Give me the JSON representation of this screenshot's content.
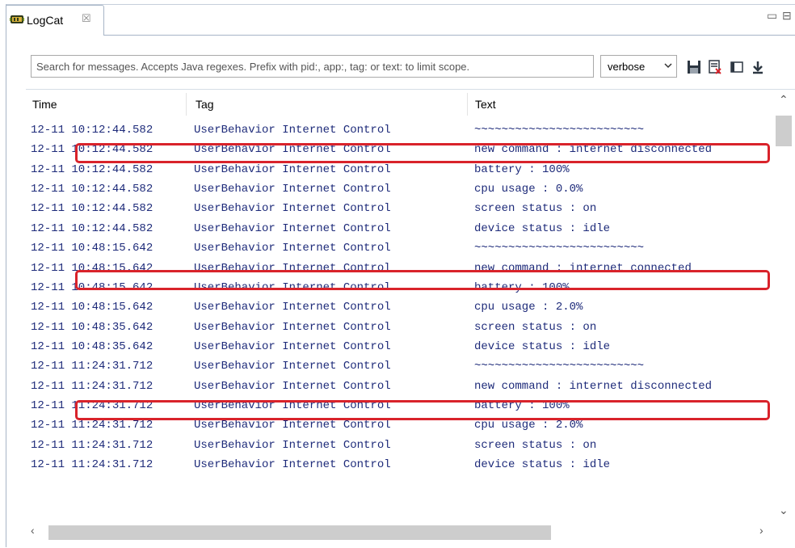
{
  "tab": {
    "title": "LogCat",
    "close": "☒"
  },
  "window_buttons": {
    "minimize": "▭",
    "maximize": "⊟"
  },
  "toolbar": {
    "search_placeholder": "Search for messages. Accepts Java regexes. Prefix with pid:, app:, tag: or text: to limit scope.",
    "level": "verbose",
    "icons": [
      "save-icon",
      "clear-log-icon",
      "toggle-panel-icon",
      "scroll-lock-icon"
    ]
  },
  "table": {
    "headers": {
      "time": "Time",
      "tag": "Tag",
      "text": "Text"
    },
    "rows": [
      {
        "time": "12-11 10:12:44.582",
        "tag": "UserBehavior Internet Control",
        "text": "~~~~~~~~~~~~~~~~~~~~~~~~~"
      },
      {
        "time": "12-11 10:12:44.582",
        "tag": "UserBehavior Internet Control",
        "text": "new command : internet disconnected"
      },
      {
        "time": "12-11 10:12:44.582",
        "tag": "UserBehavior Internet Control",
        "text": "battery : 100%"
      },
      {
        "time": "12-11 10:12:44.582",
        "tag": "UserBehavior Internet Control",
        "text": "cpu usage : 0.0%"
      },
      {
        "time": "12-11 10:12:44.582",
        "tag": "UserBehavior Internet Control",
        "text": "screen status : on"
      },
      {
        "time": "12-11 10:12:44.582",
        "tag": "UserBehavior Internet Control",
        "text": "device status : idle"
      },
      {
        "time": "12-11 10:48:15.642",
        "tag": "UserBehavior Internet Control",
        "text": "~~~~~~~~~~~~~~~~~~~~~~~~~"
      },
      {
        "time": "12-11 10:48:15.642",
        "tag": "UserBehavior Internet Control",
        "text": "new command : internet connected"
      },
      {
        "time": "12-11 10:48:15.642",
        "tag": "UserBehavior Internet Control",
        "text": "battery : 100%"
      },
      {
        "time": "12-11 10:48:15.642",
        "tag": "UserBehavior Internet Control",
        "text": "cpu usage : 2.0%"
      },
      {
        "time": "12-11 10:48:35.642",
        "tag": "UserBehavior Internet Control",
        "text": "screen status : on"
      },
      {
        "time": "12-11 10:48:35.642",
        "tag": "UserBehavior Internet Control",
        "text": "device status : idle"
      },
      {
        "time": "12-11 11:24:31.712",
        "tag": "UserBehavior Internet Control",
        "text": "~~~~~~~~~~~~~~~~~~~~~~~~~"
      },
      {
        "time": "12-11 11:24:31.712",
        "tag": "UserBehavior Internet Control",
        "text": "new command : internet disconnected"
      },
      {
        "time": "12-11 11:24:31.712",
        "tag": "UserBehavior Internet Control",
        "text": "battery : 100%"
      },
      {
        "time": "12-11 11:24:31.712",
        "tag": "UserBehavior Internet Control",
        "text": "cpu usage : 2.0%"
      },
      {
        "time": "12-11 11:24:31.712",
        "tag": "UserBehavior Internet Control",
        "text": "screen status : on"
      },
      {
        "time": "12-11 11:24:31.712",
        "tag": "UserBehavior Internet Control",
        "text": "device status : idle"
      }
    ]
  },
  "highlight_color": "#d9232b",
  "text_color": "#1e2b7a"
}
